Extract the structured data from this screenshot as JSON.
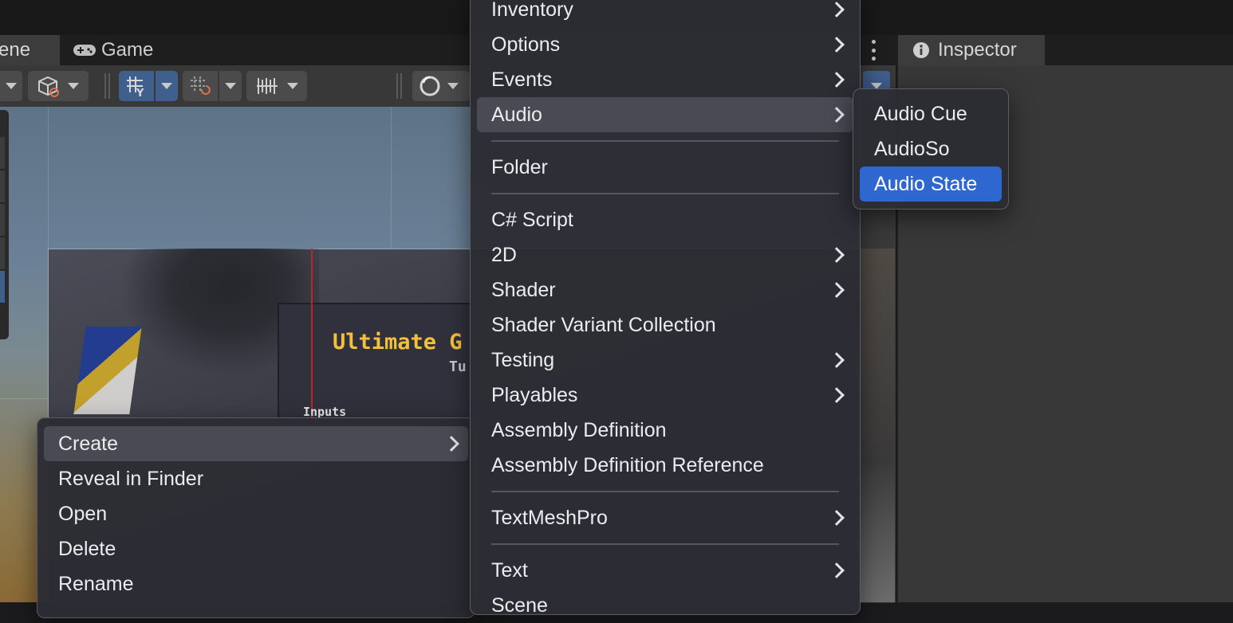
{
  "tabs": {
    "scene_label": "ene",
    "game_label": "Game",
    "inspector_label": "Inspector"
  },
  "toolbar": {
    "icons": [
      "draw-mode-dropdown",
      "shading-cube-icon",
      "grid-snap-icon",
      "grid-increment-icon",
      "grid-ruler-icon",
      "gizmo-sphere-icon"
    ]
  },
  "game_view": {
    "title": "Ultimate G",
    "subtitle": "Tu",
    "inputs_label": "Inputs"
  },
  "context_menu": {
    "items": [
      {
        "label": "Create",
        "submenu": true
      },
      {
        "label": "Reveal in Finder",
        "submenu": false
      },
      {
        "label": "Open",
        "submenu": false
      },
      {
        "label": "Delete",
        "submenu": false
      },
      {
        "label": "Rename",
        "submenu": false
      }
    ]
  },
  "create_menu": {
    "items": [
      {
        "label": "Inventory",
        "submenu": true
      },
      {
        "label": "Options",
        "submenu": true
      },
      {
        "label": "Events",
        "submenu": true
      },
      {
        "label": "Audio",
        "submenu": true
      },
      {
        "label": "Folder",
        "submenu": false
      },
      {
        "label": "C# Script",
        "submenu": false
      },
      {
        "label": "2D",
        "submenu": true
      },
      {
        "label": "Shader",
        "submenu": true
      },
      {
        "label": "Shader Variant Collection",
        "submenu": false
      },
      {
        "label": "Testing",
        "submenu": true
      },
      {
        "label": "Playables",
        "submenu": true
      },
      {
        "label": "Assembly Definition",
        "submenu": false
      },
      {
        "label": "Assembly Definition Reference",
        "submenu": false
      },
      {
        "label": "TextMeshPro",
        "submenu": true
      },
      {
        "label": "Text",
        "submenu": true
      },
      {
        "label": "Scene",
        "submenu": false
      }
    ]
  },
  "audio_menu": {
    "items": [
      {
        "label": "Audio Cue"
      },
      {
        "label": "AudioSo"
      },
      {
        "label": "Audio State"
      }
    ]
  },
  "colors": {
    "selection": "#2f67d0",
    "title_yellow": "#f2c03a",
    "toolbar_active": "#3f5f8c"
  }
}
